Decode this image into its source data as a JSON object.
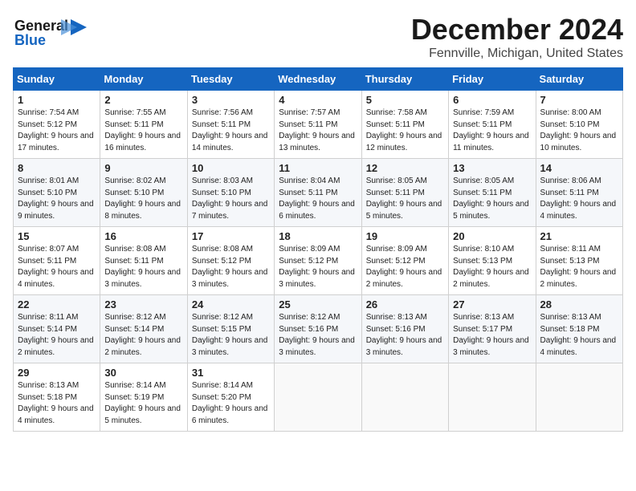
{
  "header": {
    "logo_general": "General",
    "logo_blue": "Blue",
    "month": "December 2024",
    "location": "Fennville, Michigan, United States"
  },
  "days_of_week": [
    "Sunday",
    "Monday",
    "Tuesday",
    "Wednesday",
    "Thursday",
    "Friday",
    "Saturday"
  ],
  "weeks": [
    [
      {
        "day": "1",
        "sunrise": "7:54 AM",
        "sunset": "5:12 PM",
        "daylight": "9 hours and 17 minutes."
      },
      {
        "day": "2",
        "sunrise": "7:55 AM",
        "sunset": "5:11 PM",
        "daylight": "9 hours and 16 minutes."
      },
      {
        "day": "3",
        "sunrise": "7:56 AM",
        "sunset": "5:11 PM",
        "daylight": "9 hours and 14 minutes."
      },
      {
        "day": "4",
        "sunrise": "7:57 AM",
        "sunset": "5:11 PM",
        "daylight": "9 hours and 13 minutes."
      },
      {
        "day": "5",
        "sunrise": "7:58 AM",
        "sunset": "5:11 PM",
        "daylight": "9 hours and 12 minutes."
      },
      {
        "day": "6",
        "sunrise": "7:59 AM",
        "sunset": "5:11 PM",
        "daylight": "9 hours and 11 minutes."
      },
      {
        "day": "7",
        "sunrise": "8:00 AM",
        "sunset": "5:10 PM",
        "daylight": "9 hours and 10 minutes."
      }
    ],
    [
      {
        "day": "8",
        "sunrise": "8:01 AM",
        "sunset": "5:10 PM",
        "daylight": "9 hours and 9 minutes."
      },
      {
        "day": "9",
        "sunrise": "8:02 AM",
        "sunset": "5:10 PM",
        "daylight": "9 hours and 8 minutes."
      },
      {
        "day": "10",
        "sunrise": "8:03 AM",
        "sunset": "5:10 PM",
        "daylight": "9 hours and 7 minutes."
      },
      {
        "day": "11",
        "sunrise": "8:04 AM",
        "sunset": "5:11 PM",
        "daylight": "9 hours and 6 minutes."
      },
      {
        "day": "12",
        "sunrise": "8:05 AM",
        "sunset": "5:11 PM",
        "daylight": "9 hours and 5 minutes."
      },
      {
        "day": "13",
        "sunrise": "8:05 AM",
        "sunset": "5:11 PM",
        "daylight": "9 hours and 5 minutes."
      },
      {
        "day": "14",
        "sunrise": "8:06 AM",
        "sunset": "5:11 PM",
        "daylight": "9 hours and 4 minutes."
      }
    ],
    [
      {
        "day": "15",
        "sunrise": "8:07 AM",
        "sunset": "5:11 PM",
        "daylight": "9 hours and 4 minutes."
      },
      {
        "day": "16",
        "sunrise": "8:08 AM",
        "sunset": "5:11 PM",
        "daylight": "9 hours and 3 minutes."
      },
      {
        "day": "17",
        "sunrise": "8:08 AM",
        "sunset": "5:12 PM",
        "daylight": "9 hours and 3 minutes."
      },
      {
        "day": "18",
        "sunrise": "8:09 AM",
        "sunset": "5:12 PM",
        "daylight": "9 hours and 3 minutes."
      },
      {
        "day": "19",
        "sunrise": "8:09 AM",
        "sunset": "5:12 PM",
        "daylight": "9 hours and 2 minutes."
      },
      {
        "day": "20",
        "sunrise": "8:10 AM",
        "sunset": "5:13 PM",
        "daylight": "9 hours and 2 minutes."
      },
      {
        "day": "21",
        "sunrise": "8:11 AM",
        "sunset": "5:13 PM",
        "daylight": "9 hours and 2 minutes."
      }
    ],
    [
      {
        "day": "22",
        "sunrise": "8:11 AM",
        "sunset": "5:14 PM",
        "daylight": "9 hours and 2 minutes."
      },
      {
        "day": "23",
        "sunrise": "8:12 AM",
        "sunset": "5:14 PM",
        "daylight": "9 hours and 2 minutes."
      },
      {
        "day": "24",
        "sunrise": "8:12 AM",
        "sunset": "5:15 PM",
        "daylight": "9 hours and 3 minutes."
      },
      {
        "day": "25",
        "sunrise": "8:12 AM",
        "sunset": "5:16 PM",
        "daylight": "9 hours and 3 minutes."
      },
      {
        "day": "26",
        "sunrise": "8:13 AM",
        "sunset": "5:16 PM",
        "daylight": "9 hours and 3 minutes."
      },
      {
        "day": "27",
        "sunrise": "8:13 AM",
        "sunset": "5:17 PM",
        "daylight": "9 hours and 3 minutes."
      },
      {
        "day": "28",
        "sunrise": "8:13 AM",
        "sunset": "5:18 PM",
        "daylight": "9 hours and 4 minutes."
      }
    ],
    [
      {
        "day": "29",
        "sunrise": "8:13 AM",
        "sunset": "5:18 PM",
        "daylight": "9 hours and 4 minutes."
      },
      {
        "day": "30",
        "sunrise": "8:14 AM",
        "sunset": "5:19 PM",
        "daylight": "9 hours and 5 minutes."
      },
      {
        "day": "31",
        "sunrise": "8:14 AM",
        "sunset": "5:20 PM",
        "daylight": "9 hours and 6 minutes."
      },
      null,
      null,
      null,
      null
    ]
  ]
}
